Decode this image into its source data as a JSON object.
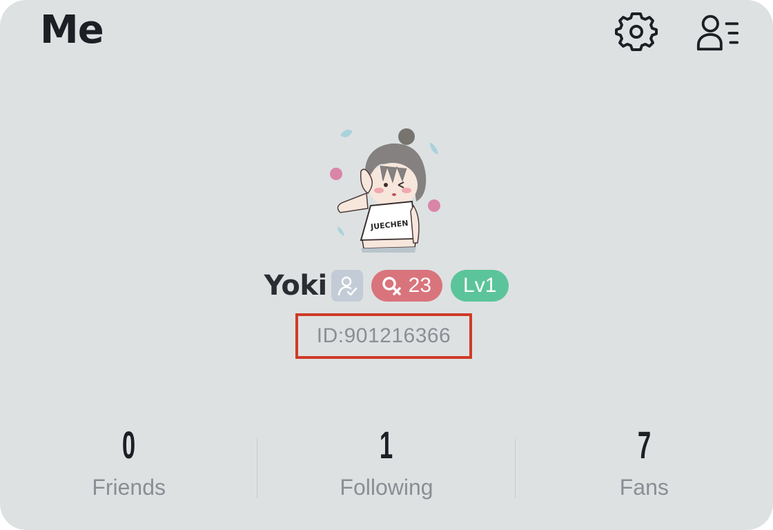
{
  "header": {
    "title": "Me",
    "settings_icon": "gear-icon",
    "profile_icon": "user-list-icon"
  },
  "profile": {
    "avatar_icon": "avatar-illustration",
    "name": "Yoki",
    "verify_icon": "verified-user-icon",
    "age": "23",
    "gender_icon": "female-icon",
    "level": "Lv1",
    "user_id": "ID:901216366"
  },
  "stats": [
    {
      "value": "0",
      "label": "Friends"
    },
    {
      "value": "1",
      "label": "Following"
    },
    {
      "value": "7",
      "label": "Fans"
    }
  ],
  "colors": {
    "background": "#dde1e2",
    "gender_badge": "#d9747c",
    "level_badge": "#5cc49a",
    "highlight_box": "#d03a26"
  }
}
